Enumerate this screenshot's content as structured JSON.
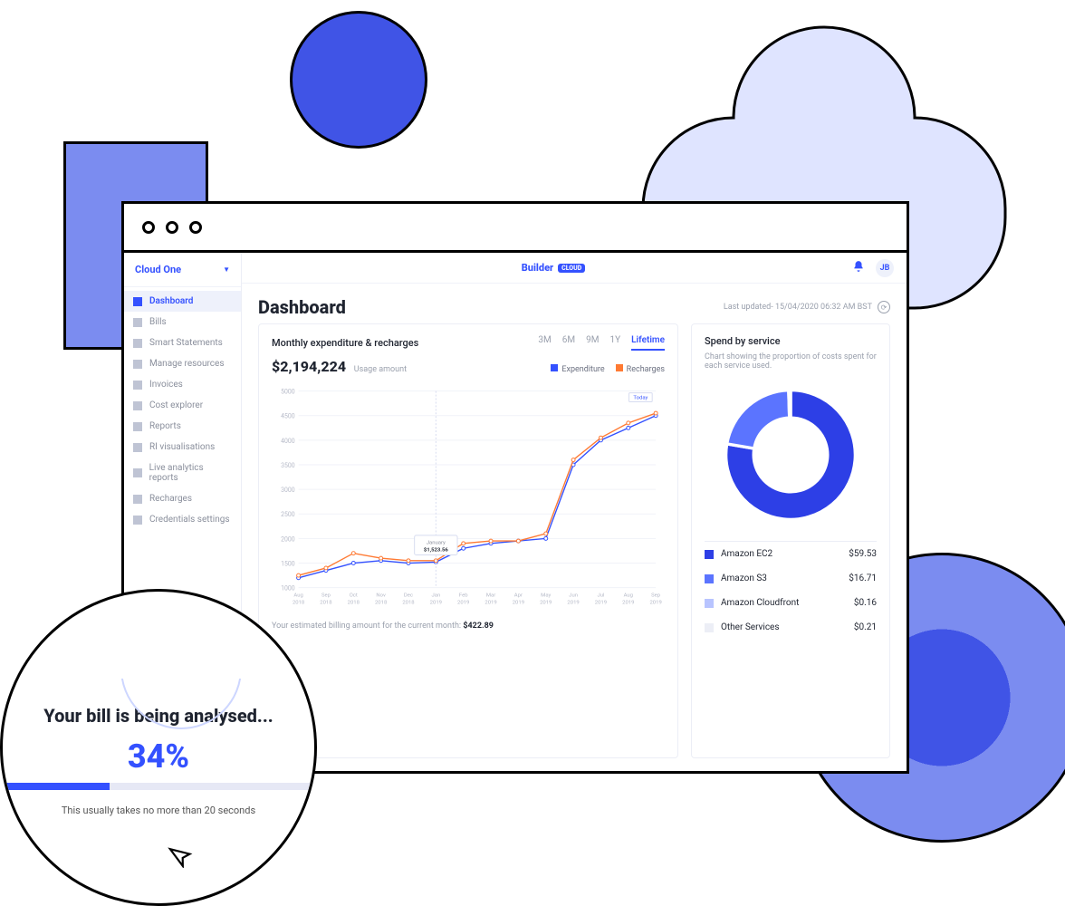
{
  "org_name": "Cloud One",
  "brand": {
    "name": "Builder",
    "badge": "CLOUD"
  },
  "avatar": "JB",
  "page_title": "Dashboard",
  "last_updated": "Last updated- 15/04/2020 06:32 AM BST",
  "sidebar": {
    "items": [
      {
        "label": "Dashboard",
        "active": true
      },
      {
        "label": "Bills",
        "active": false
      },
      {
        "label": "Smart Statements",
        "active": false
      },
      {
        "label": "Manage resources",
        "active": false
      },
      {
        "label": "Invoices",
        "active": false
      },
      {
        "label": "Cost explorer",
        "active": false
      },
      {
        "label": "Reports",
        "active": false
      },
      {
        "label": "RI visualisations",
        "active": false
      },
      {
        "label": "Live analytics reports",
        "active": false
      },
      {
        "label": "Recharges",
        "active": false
      },
      {
        "label": "Credentials settings",
        "active": false
      }
    ]
  },
  "chart_card": {
    "title": "Monthly expenditure & recharges",
    "ranges": [
      "3M",
      "6M",
      "9M",
      "1Y",
      "Lifetime"
    ],
    "active_range": "Lifetime",
    "amount": "$2,194,224",
    "amount_label": "Usage amount",
    "legend": {
      "a": "Expenditure",
      "b": "Recharges"
    },
    "tooltip": {
      "month": "January",
      "value": "$1,523.56"
    },
    "today_label": "Today",
    "footer_prefix": "Your estimated billing amount for the current month: ",
    "footer_value": "$422.89"
  },
  "spend_card": {
    "title": "Spend by service",
    "desc": "Chart showing the proportion of costs spent for each service used.",
    "items": [
      {
        "label": "Amazon EC2",
        "value": "$59.53",
        "color": "#2d3fe6"
      },
      {
        "label": "Amazon S3",
        "value": "$16.71",
        "color": "#5b74ff"
      },
      {
        "label": "Amazon Cloudfront",
        "value": "$0.16",
        "color": "#b8c4ff"
      },
      {
        "label": "Other Services",
        "value": "$0.21",
        "color": "#eceef6"
      }
    ]
  },
  "analysis": {
    "title": "Your bill is being analysed...",
    "pct_text": "34%",
    "pct": 34,
    "hint": "This usually takes no more than 20 seconds"
  },
  "chart_data": {
    "type": "line",
    "title": "Monthly expenditure & recharges",
    "xlabel": "",
    "ylabel": "",
    "ylim": [
      1000,
      5000
    ],
    "y_ticks": [
      1000,
      1500,
      2000,
      2500,
      3000,
      3500,
      4000,
      4500,
      5000
    ],
    "categories": [
      "Aug 2018",
      "Sep 2018",
      "Oct 2018",
      "Nov 2018",
      "Dec 2018",
      "Jan 2019",
      "Feb 2019",
      "Mar 2019",
      "Apr 2019",
      "May 2019",
      "Jun 2019",
      "Jul 2019",
      "Aug 2019",
      "Sep 2019"
    ],
    "series": [
      {
        "name": "Expenditure",
        "color": "#3451ff",
        "values": [
          1200,
          1350,
          1500,
          1550,
          1500,
          1520,
          1800,
          1900,
          1950,
          2000,
          3500,
          4000,
          4250,
          4500
        ]
      },
      {
        "name": "Recharges",
        "color": "#ff7a33",
        "values": [
          1250,
          1400,
          1700,
          1600,
          1550,
          1550,
          1900,
          1950,
          1950,
          2100,
          3600,
          4050,
          4350,
          4550
        ]
      }
    ],
    "annotations": [
      {
        "x": "Jan 2019",
        "label": "January",
        "value": "$1,523.56"
      },
      {
        "x": "Sep 2019",
        "label": "Today"
      }
    ],
    "donut": {
      "type": "pie",
      "series": [
        {
          "name": "Amazon EC2",
          "value": 59.53,
          "color": "#2d3fe6"
        },
        {
          "name": "Amazon S3",
          "value": 16.71,
          "color": "#5b74ff"
        },
        {
          "name": "Amazon Cloudfront",
          "value": 0.16,
          "color": "#b8c4ff"
        },
        {
          "name": "Other Services",
          "value": 0.21,
          "color": "#eceef6"
        }
      ]
    }
  }
}
